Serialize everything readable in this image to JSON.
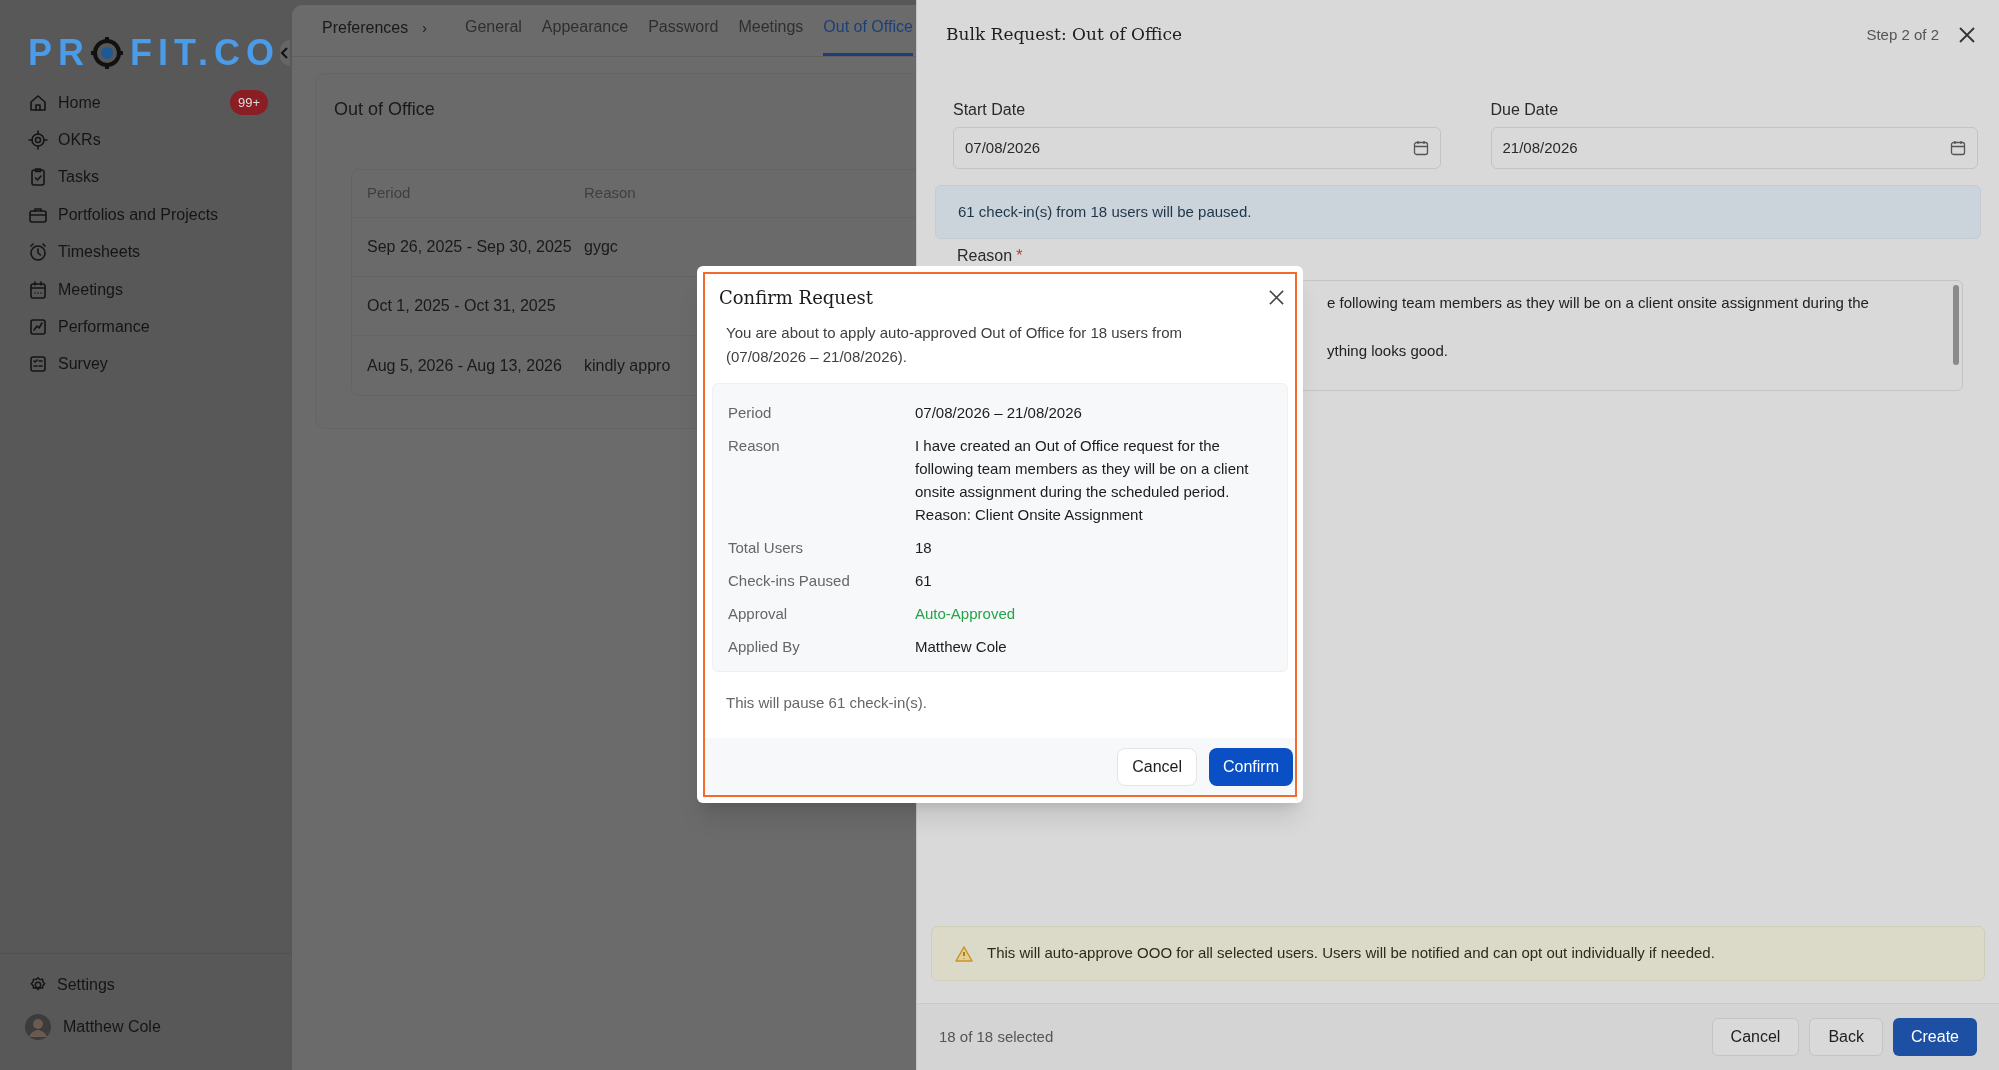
{
  "logo": {
    "left": "PR",
    "right": "FIT.CO"
  },
  "sidebar": {
    "items": [
      {
        "label": "Home",
        "badge": "99+"
      },
      {
        "label": "OKRs"
      },
      {
        "label": "Tasks"
      },
      {
        "label": "Portfolios and Projects"
      },
      {
        "label": "Timesheets"
      },
      {
        "label": "Meetings"
      },
      {
        "label": "Performance"
      },
      {
        "label": "Survey"
      }
    ],
    "settings": "Settings",
    "user": "Matthew Cole"
  },
  "breadcrumb": {
    "label": "Preferences",
    "separator": "›"
  },
  "tabs": [
    {
      "label": "General",
      "selected": false
    },
    {
      "label": "Appearance",
      "selected": false
    },
    {
      "label": "Password",
      "selected": false
    },
    {
      "label": "Meetings",
      "selected": false
    },
    {
      "label": "Out of Office",
      "selected": true
    }
  ],
  "card": {
    "title": "Out of Office",
    "columns": [
      "Period",
      "Reason"
    ],
    "rows": [
      {
        "period": "Sep 26, 2025 - Sep 30, 2025",
        "reason": "gygc"
      },
      {
        "period": "Oct 1, 2025 - Oct 31, 2025"
      },
      {
        "period": "Aug 5, 2026 - Aug 13, 2026",
        "reason": "kindly appro"
      }
    ]
  },
  "drawer": {
    "title": "Bulk Request: Out of Office",
    "step": "Step 2 of 2",
    "fields": [
      {
        "label": "Start Date",
        "value": "07/08/2026"
      },
      {
        "label": "Due Date",
        "value": "21/08/2026"
      }
    ],
    "info": "61 check-in(s) from 18 users will be paused.",
    "reason_label": "Reason",
    "required_mark": "*",
    "reason_lines": [
      "e following team members as they will be on a client onsite assignment during the",
      "ything looks good."
    ],
    "warning": "This will auto-approve OOO for all selected users. Users will be notified and can opt out individually if needed.",
    "selected_count": "18 of 18 selected",
    "buttons": [
      {
        "label": "Cancel",
        "kind": "secondary"
      },
      {
        "label": "Back",
        "kind": "secondary"
      },
      {
        "label": "Create",
        "kind": "primary"
      }
    ]
  },
  "modal": {
    "title": "Confirm Request",
    "message": "You are about to apply auto-approved Out of Office for 18 users from (07/08/2026 – 21/08/2026).",
    "details": [
      {
        "label": "Period",
        "value": "07/08/2026 – 21/08/2026",
        "kind": "text"
      },
      {
        "label": "Reason",
        "value": "I have created an Out of Office request for the following team members as they will be on a client onsite assignment during the scheduled period. Reason: Client Onsite Assignment",
        "kind": "text"
      },
      {
        "label": "Total Users",
        "value": "18",
        "kind": "text"
      },
      {
        "label": "Check-ins Paused",
        "value": "61",
        "kind": "text"
      },
      {
        "label": "Approval",
        "value": "Auto-Approved",
        "kind": "success"
      },
      {
        "label": "Applied By",
        "value": "Matthew Cole",
        "kind": "text"
      }
    ],
    "note": "This will pause 61 check-in(s).",
    "buttons": [
      {
        "label": "Cancel",
        "kind": "secondary"
      },
      {
        "label": "Confirm",
        "kind": "primary"
      }
    ]
  }
}
